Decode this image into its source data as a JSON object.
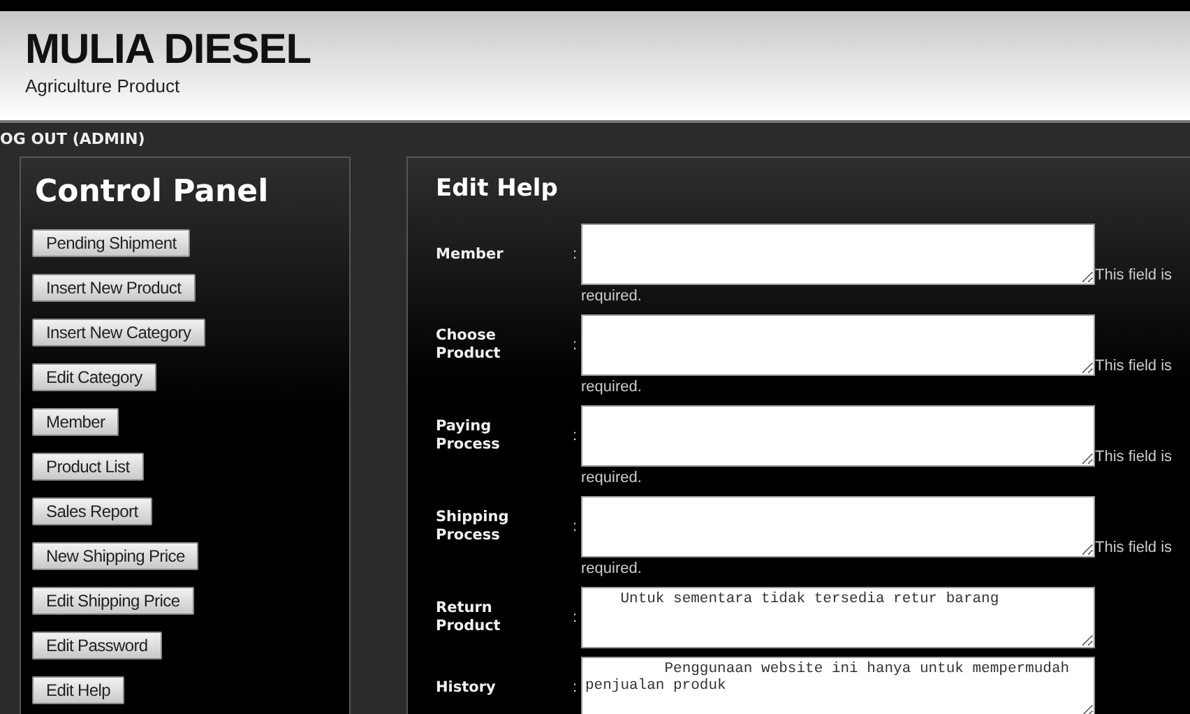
{
  "header": {
    "title": "MULIA DIESEL",
    "subtitle": "Agriculture Product"
  },
  "top_bar": {
    "logout": "OG OUT (ADMIN)"
  },
  "sidebar": {
    "title": "Control Panel",
    "items": [
      {
        "label": "Pending Shipment"
      },
      {
        "label": "Insert New Product"
      },
      {
        "label": "Insert New Category"
      },
      {
        "label": "Edit Category"
      },
      {
        "label": "Member"
      },
      {
        "label": "Product List"
      },
      {
        "label": "Sales Report"
      },
      {
        "label": "New Shipping Price"
      },
      {
        "label": "Edit Shipping Price"
      },
      {
        "label": "Edit Password"
      },
      {
        "label": "Edit Help"
      }
    ]
  },
  "form": {
    "title": "Edit Help",
    "fields": [
      {
        "label": "Member",
        "separator": ":",
        "error": "This field is required."
      },
      {
        "label": "Choose Product",
        "separator": ":",
        "error": "This field is required."
      },
      {
        "label": "Paying Process",
        "separator": ":",
        "error": "This field is required."
      },
      {
        "label": "Shipping Process",
        "separator": ":",
        "error": "This field is required."
      },
      {
        "label": "Return Product",
        "separator": ":",
        "value": "    Untuk sementara tidak tersedia retur barang"
      },
      {
        "label": "History",
        "separator": ":",
        "value": "         Penggunaan website ini hanya untuk mempermudah penjualan produk"
      }
    ]
  }
}
